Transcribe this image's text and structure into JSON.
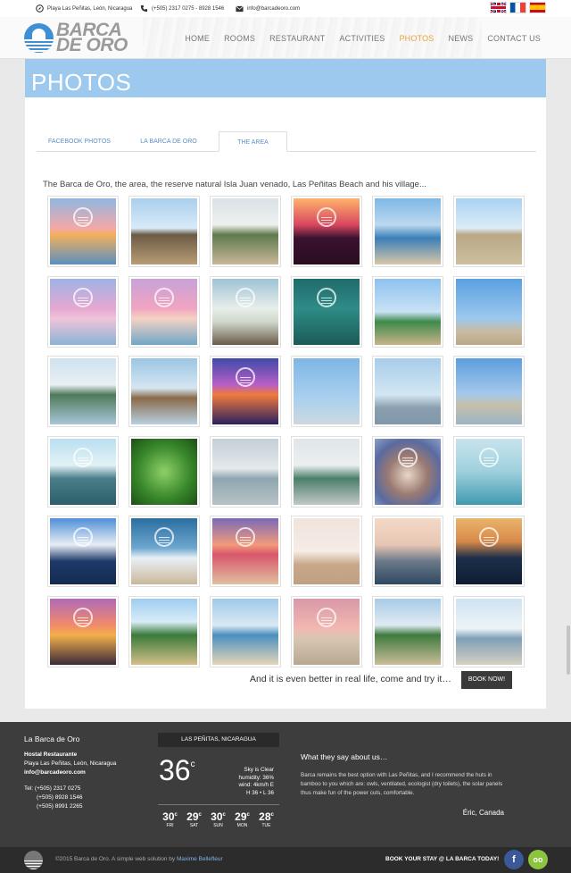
{
  "topbar": {
    "address": "Playa Las Peñitas, León, Nicaragua",
    "phone": "(+505) 2317 0275 - 8928 1546",
    "email": "info@barcadeoro.com",
    "flags": [
      "uk-flag",
      "france-flag",
      "spain-flag"
    ]
  },
  "logo": {
    "line1": "BARCA",
    "line2": "DE ORO"
  },
  "nav": {
    "items": [
      "HOME",
      "ROOMS",
      "RESTAURANT",
      "ACTIVITIES",
      "PHOTOS",
      "NEWS",
      "CONTACT US"
    ],
    "active": "PHOTOS"
  },
  "page": {
    "title": "PHOTOS",
    "tabs": [
      "FACEBOOK PHOTOS",
      "LA BARCA DE ORO",
      "THE AREA"
    ],
    "active_tab": "THE AREA",
    "intro": "The Barca de Oro, the area, the reserve natural Isla Juan venado, Las Peñitas Beach and his village...",
    "cta_text": "And it is even better in real life, come and try it…",
    "book_button": "BOOK NOW!"
  },
  "gallery": {
    "rows": 6,
    "cols": 6,
    "photos": [
      {
        "bg": "linear-gradient(#8fb7e0 0%, #f4a8a8 45%, #f3b05c 55%, #5a8fc0 100%)",
        "wm": true
      },
      {
        "bg": "linear-gradient(#a8cfee 0%, #d9eaf7 45%, #6b5a45 55%, #b89d74 100%)",
        "wm": false
      },
      {
        "bg": "linear-gradient(#d9e2e8 0%, #eef0ee 40%, #5f7a4c 55%, #c8b79a 100%)",
        "wm": false
      },
      {
        "bg": "linear-gradient(#ffb36b 0%, #d9465f 40%, #3a1230 60%, #2a0d20 100%)",
        "wm": true
      },
      {
        "bg": "linear-gradient(#7eb8e6 0%, #bcd9ef 40%, #3a7fb8 60%, #d8c7a8 100%)",
        "wm": false
      },
      {
        "bg": "linear-gradient(#a9d2f2 0%, #dcecf7 45%, #b9a886 55%, #cdbf9f 100%)",
        "wm": false
      },
      {
        "bg": "linear-gradient(#9fb3e6 0%, #e6a8d2 45%, #f0c4d8 60%, #8ab4d6 100%)",
        "wm": true
      },
      {
        "bg": "linear-gradient(#c7a2d8 0%, #f2a4c2 45%, #f5d2c2 60%, #6fa6c8 100%)",
        "wm": true
      },
      {
        "bg": "linear-gradient(#9ec3d6 0%, #e8eeea 45%, #cfd8cc 65%, #6b5b4a 100%)",
        "wm": true
      },
      {
        "bg": "linear-gradient(#1f6b6b 0%, #2e8c86 45%, #1b5a58 100%)",
        "wm": true
      },
      {
        "bg": "linear-gradient(#8ec2ee 0%, #c9e2f5 50%, #3d8a4a 65%, #c8b38a 100%)",
        "wm": false
      },
      {
        "bg": "linear-gradient(#5aa0e0 0%, #9cc8ee 60%, #c9bba0 80%, #b8a888 100%)",
        "wm": false
      },
      {
        "bg": "linear-gradient(#cfe3f0 0%, #e9eff2 40%, #4e7a5a 55%, #a9c6d8 100%)",
        "wm": false
      },
      {
        "bg": "linear-gradient(#9bc4e4 0%, #d6e6f2 45%, #8a6a4a 60%, #b8d0e0 100%)",
        "wm": false
      },
      {
        "bg": "linear-gradient(#3f4aa8 0%, #b65fc6 40%, #f07a3c 55%, #2a2060 100%)",
        "wm": true
      },
      {
        "bg": "linear-gradient(#7fb6e6 0%, #a9d0ee 60%, #cdd8e0 100%)",
        "wm": false
      },
      {
        "bg": "linear-gradient(#a6cdea 0%, #d3e6f2 55%, #8a9fae 75%, #7f98aa 100%)",
        "wm": false
      },
      {
        "bg": "linear-gradient(#5c9ee0 0%, #a6c9ea 55%, #c7c0a8 70%, #9bb4c6 100%)",
        "wm": false
      },
      {
        "bg": "linear-gradient(#b9dff0 0%, #e2f2f5 40%, #4a7f8a 60%, #2d5f6a 100%)",
        "wm": true
      },
      {
        "bg": "radial-gradient(circle at 50% 50%, #8fcf6a 0%, #3a8a2c 55%, #1d4f17 100%)",
        "wm": false
      },
      {
        "bg": "linear-gradient(#c4cfd6 0%, #e4e9ec 45%, #8fa6b0 60%, #b7c2c6 100%)",
        "wm": false
      },
      {
        "bg": "linear-gradient(#dfe6e8 0%, #eceff0 40%, #4a7f6a 60%, #c2c9c8 100%)",
        "wm": false
      },
      {
        "bg": "radial-gradient(circle at 50% 55%, #e8d6c6 0%, #9a7a72 40%, #5a6aa0 70%, #8aa0c8 100%)",
        "wm": true
      },
      {
        "bg": "linear-gradient(#c8e4ee 0%, #9ed0dc 50%, #3f9ab0 100%)",
        "wm": true
      },
      {
        "bg": "linear-gradient(#4f8fd8 0%, #e8eef5 40%, #1f3a6a 65%, #142a50 100%)",
        "wm": true
      },
      {
        "bg": "linear-gradient(#2a6ea0 0%, #6ea7cf 45%, #e8f0f5 60%, #c9b89a 100%)",
        "wm": true
      },
      {
        "bg": "linear-gradient(#7a6ab8 0%, #f29a7a 40%, #d8566a 55%, #e0c0a0 100%)",
        "wm": true
      },
      {
        "bg": "linear-gradient(#f0e4dc 0%, #f6ece6 50%, #c9a88a 70%, #bfa080 100%)",
        "wm": false
      },
      {
        "bg": "linear-gradient(#f3d9c6 0%, #e8c6b4 40%, #6a7a8a 65%, #2f4860 100%)",
        "wm": false
      },
      {
        "bg": "linear-gradient(#e8b46a 0%, #d98a4a 35%, #1c2f4a 60%, #0f1d33 100%)",
        "wm": true
      },
      {
        "bg": "linear-gradient(#b06ab8 0%, #f28a6a 40%, #f3b04a 55%, #3a2a3a 100%)",
        "wm": true
      },
      {
        "bg": "linear-gradient(#9fcdf0 0%, #d8ecf6 35%, #3a7a3a 55%, #d4bf8a 100%)",
        "wm": false
      },
      {
        "bg": "linear-gradient(#9fc9ea 0%, #dbe9f3 40%, #4a8fc0 55%, #e4d6b8 100%)",
        "wm": false
      },
      {
        "bg": "linear-gradient(#d998a8 0%, #f2b8b0 45%, #d9c6b2 60%, #b8a890 100%)",
        "wm": true
      },
      {
        "bg": "linear-gradient(#a8cbe8 0%, #dfeaf2 40%, #3e7a3e 55%, #cbbd9a 100%)",
        "wm": false
      },
      {
        "bg": "linear-gradient(#cfe3f2 0%, #eef4f8 45%, #7f9fb8 60%, #d6d0c2 100%)",
        "wm": false
      }
    ]
  },
  "footer": {
    "brand": "La Barca de Oro",
    "subtitle": "Hostal Restaurante",
    "address": "Playa Las Peñitas, León, Nicaragua",
    "email": "info@barcadeoro.com",
    "tel1": "Tel: (+505) 2317 0275",
    "tel2": "(+505) 8928 1546",
    "tel3": "(+505) 8991 2265",
    "weather": {
      "location": "LAS PEÑITAS, NICARAGUA",
      "temp": "36",
      "unit": "c",
      "condition": "Sky is Clear",
      "humidity": "humidity: 36%",
      "wind": "wind: 4km/h E",
      "hilo": "H 36 • L 36",
      "forecast": [
        {
          "temp": "30",
          "day": "FRI"
        },
        {
          "temp": "29",
          "day": "SAT"
        },
        {
          "temp": "30",
          "day": "SUN"
        },
        {
          "temp": "29",
          "day": "MON"
        },
        {
          "temp": "28",
          "day": "TUE"
        }
      ]
    },
    "testimonial_heading": "What they say about us…",
    "testimonial": "Barca remains the best option with Las Peñitas, and I recommend the huts in bamboo to you which are: owls, ventilated, ecologist (dry toilets), the solar panels thus make fun of the power cuts, comfortable.",
    "testimonial_author": "Éric, Canada"
  },
  "bottombar": {
    "copyright": "©2015 Barca de Oro. A simple web solution by",
    "author": "Maxime Bellefleur",
    "book_stay": "BOOK YOUR STAY @ LA BARCA TODAY!",
    "facebook": "f",
    "tripadvisor": "oo"
  }
}
